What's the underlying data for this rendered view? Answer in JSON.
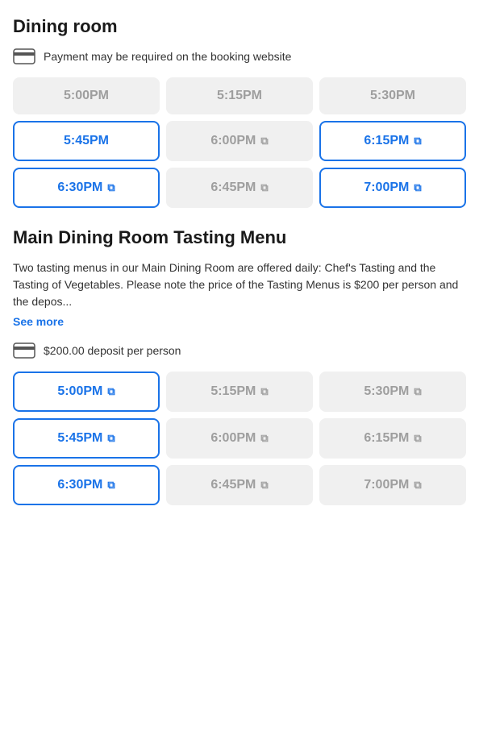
{
  "sections": [
    {
      "id": "dining-room",
      "title": "Dining room",
      "payment_notice": "Payment may be required on the booking website",
      "time_slots": [
        {
          "label": "5:00PM",
          "state": "unavailable",
          "external": false
        },
        {
          "label": "5:15PM",
          "state": "unavailable",
          "external": false
        },
        {
          "label": "5:30PM",
          "state": "unavailable",
          "external": false
        },
        {
          "label": "5:45PM",
          "state": "selected",
          "external": false
        },
        {
          "label": "6:00PM",
          "state": "external-gray",
          "external": true
        },
        {
          "label": "6:15PM",
          "state": "external-blue",
          "external": true
        },
        {
          "label": "6:30PM",
          "state": "external-blue",
          "external": true
        },
        {
          "label": "6:45PM",
          "state": "external-gray",
          "external": true
        },
        {
          "label": "7:00PM",
          "state": "external-blue",
          "external": true
        }
      ]
    },
    {
      "id": "tasting-menu",
      "title": "Main Dining Room Tasting Menu",
      "description": "Two tasting menus in our Main Dining Room are offered daily: Chef's Tasting and the Tasting of Vegetables. Please note the price of the Tasting Menus is $200 per person and the depos...",
      "see_more_label": "See more",
      "deposit_notice": "$200.00 deposit per person",
      "time_slots": [
        {
          "label": "5:00PM",
          "state": "external-blue",
          "external": true
        },
        {
          "label": "5:15PM",
          "state": "external-gray",
          "external": true
        },
        {
          "label": "5:30PM",
          "state": "external-gray",
          "external": true
        },
        {
          "label": "5:45PM",
          "state": "external-blue",
          "external": true
        },
        {
          "label": "6:00PM",
          "state": "external-gray",
          "external": true
        },
        {
          "label": "6:15PM",
          "state": "external-gray",
          "external": true
        },
        {
          "label": "6:30PM",
          "state": "external-blue",
          "external": true
        },
        {
          "label": "6:45PM",
          "state": "external-gray",
          "external": true
        },
        {
          "label": "7:00PM",
          "state": "external-gray",
          "external": true
        }
      ]
    }
  ],
  "icons": {
    "external_link": "⧉",
    "card_shape": "card"
  }
}
